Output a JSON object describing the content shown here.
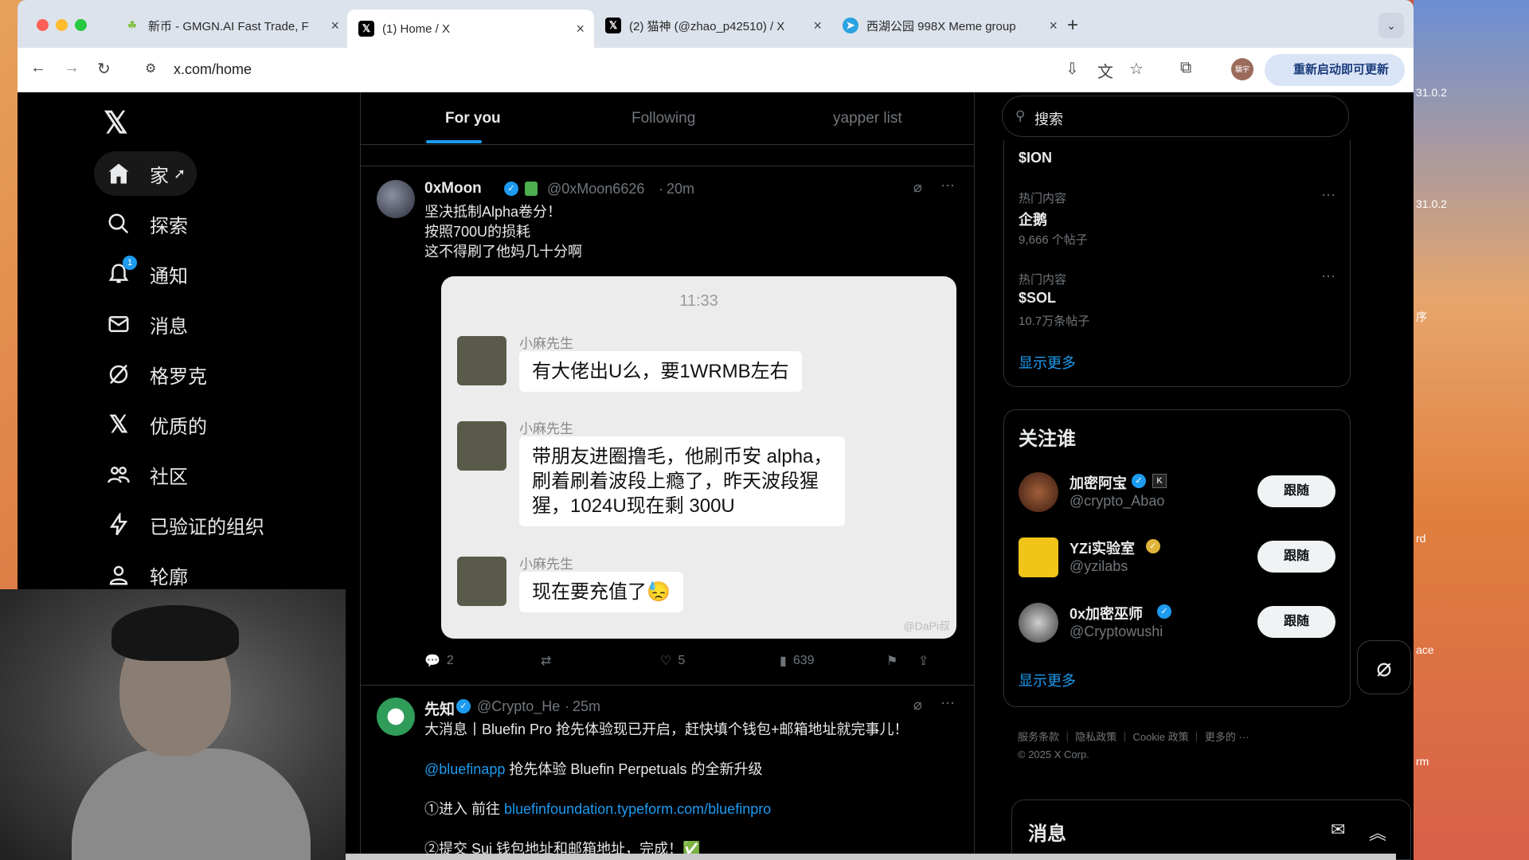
{
  "browser": {
    "tabs": [
      {
        "title": "新币 - GMGN.AI Fast Trade, F",
        "fav": "☘",
        "fav_color": "#7fbf3f"
      },
      {
        "title": "(1) Home / X",
        "fav": "𝕏",
        "fav_color": "#000000"
      },
      {
        "title": "(2) 猫神 (@zhao_p42510) / X",
        "fav": "𝕏",
        "fav_color": "#000000"
      },
      {
        "title": "西湖公园 998X Meme group",
        "fav": "➤",
        "fav_color": "#2aa3e0"
      }
    ],
    "url": "x.com/home",
    "update_button": "重新启动即可更新",
    "profile_initials": "驕宇"
  },
  "nav": {
    "items": [
      {
        "label": "家",
        "icon": "home-icon"
      },
      {
        "label": "探索",
        "icon": "search-icon"
      },
      {
        "label": "通知",
        "icon": "bell-icon",
        "badge": "1"
      },
      {
        "label": "消息",
        "icon": "mail-icon"
      },
      {
        "label": "格罗克",
        "icon": "grok-icon"
      },
      {
        "label": "优质的",
        "icon": "x-premium-icon"
      },
      {
        "label": "社区",
        "icon": "people-icon"
      },
      {
        "label": "已验证的组织",
        "icon": "lightning-icon"
      },
      {
        "label": "轮廓",
        "icon": "profile-icon"
      }
    ]
  },
  "feed": {
    "tabs": [
      "For you",
      "Following",
      "yapper list"
    ],
    "tweet1": {
      "name": "0xMoon",
      "handle": "@0xMoon6626",
      "time": "20m",
      "lines": [
        "坚决抵制Alpha卷分！",
        "按照700U的损耗",
        "这不得刷了他妈几十分啊"
      ],
      "chat": {
        "time": "11:33",
        "sender": "小麻先生",
        "msg1": "有大佬出U么，要1WRMB左右",
        "msg2_lines": [
          "带朋友进圈撸毛，他刷币安 alpha，",
          "刷着刷着波段上瘾了，昨天波段猩",
          "猩，1024U现在剩 300U"
        ],
        "msg3": "现在要充值了😓",
        "watermark": "@DaPi叔"
      },
      "replies": "2",
      "likes": "5",
      "views": "639"
    },
    "tweet2": {
      "name": "先知",
      "handle": "@Crypto_He",
      "time": "25m",
      "line1": "大消息丨Bluefin Pro 抢先体验现已开启，赶快填个钱包+邮箱地址就完事儿！",
      "mention": "@bluefinapp",
      "line2": " 抢先体验 Bluefin Perpetuals 的全新升级",
      "step1_prefix": "①进入 前往 ",
      "step1_link": "bluefinfoundation.typeform.com/bluefinpro",
      "step2": "②提交 Sui 钱包地址和邮箱地址，完成！✅"
    }
  },
  "sidebar": {
    "search_placeholder": "搜索",
    "trends": [
      {
        "category": "",
        "name": "$ION",
        "count": ""
      },
      {
        "category": "热门内容",
        "name": "企鹅",
        "count": "9,666 个帖子"
      },
      {
        "category": "热门内容",
        "name": "$SOL",
        "count": "10.7万条帖子"
      }
    ],
    "show_more": "显示更多",
    "follow_title": "关注谁",
    "follow": [
      {
        "name": "加密阿宝",
        "handle": "@crypto_Abao",
        "button": "跟随"
      },
      {
        "name": "YZi实验室",
        "handle": "@yzilabs",
        "button": "跟随"
      },
      {
        "name": "0x加密巫师",
        "handle": "@Cryptowushi",
        "button": "跟随"
      }
    ],
    "follow_show_more": "显示更多",
    "footer_links": [
      "服务条款",
      "隐私政策",
      "Cookie 政策",
      "更多的 ···"
    ],
    "copyright": "© 2025 X Corp."
  },
  "messages_drawer": {
    "title": "消息"
  },
  "desktop": {
    "labels": [
      "31.0.2",
      "31.0.2",
      "序",
      "rd",
      "ace",
      "rm"
    ]
  }
}
